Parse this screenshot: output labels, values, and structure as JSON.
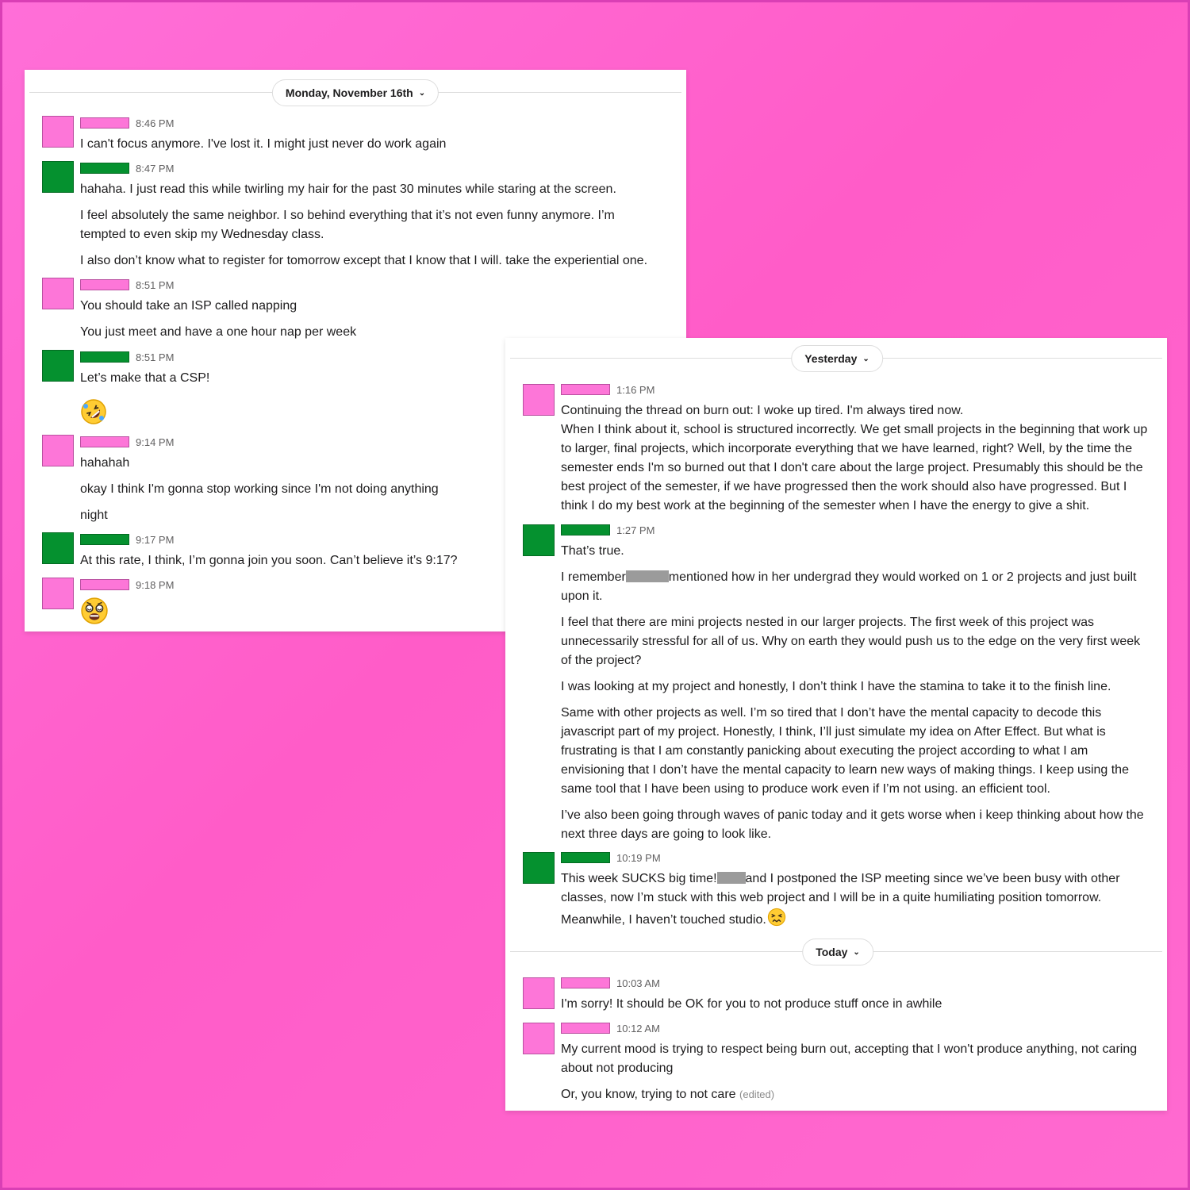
{
  "panel1": {
    "date_label": "Monday, November 16th",
    "messages": [
      {
        "time": "8:46 PM",
        "lines": [
          "I can't focus anymore. I've lost it. I might just never do work again"
        ]
      },
      {
        "time": "8:47 PM",
        "lines": [
          "hahaha. I just read this while twirling my hair for the past 30 minutes while staring at the screen.",
          "I feel absolutely the same neighbor. I so behind everything that it’s not even funny anymore. I’m tempted to even skip my Wednesday class.",
          "I also don’t know what to register for tomorrow except that I know that I will. take the experiential one."
        ]
      },
      {
        "time": "8:51 PM",
        "lines": [
          "You should take an ISP called napping",
          "You just meet and have a one hour nap per week"
        ]
      },
      {
        "time": "8:51 PM",
        "lines": [
          "Let’s make that a CSP!"
        ],
        "emoji": "rolling-on-floor-laughing-emoji"
      },
      {
        "time": "9:14 PM",
        "lines": [
          "hahahah",
          "okay I think I'm gonna stop working since I'm not doing anything",
          "night"
        ]
      },
      {
        "time": "9:17 PM",
        "lines": [
          "At this rate, I think, I’m gonna join you soon. Can’t believe it’s 9:17?"
        ]
      },
      {
        "time": "9:18 PM",
        "emoji": "dizzy-face-emoji"
      }
    ]
  },
  "panel2": {
    "date_label": "Yesterday",
    "today_label": "Today",
    "messages": [
      {
        "time": "1:16 PM",
        "lines": [
          "Continuing the thread on burn out: I woke up tired. I'm always tired now.",
          "When I think about it, school is structured incorrectly. We get small projects in the beginning that work up to larger, final projects, which incorporate everything that we have learned, right? Well, by the time the semester ends I'm so burned out that I don't care about the large project. Presumably this should be the best project of the semester, if we have progressed then the work should also have progressed. But I think I do my best work at the beginning of the semester when I have the energy to give a shit."
        ]
      },
      {
        "time": "1:27 PM",
        "lines": [
          "That’s true.",
          "I remember",
          "mentioned how in her undergrad they would worked on 1 or 2 projects and just built upon it.",
          "I feel that there are mini projects nested in our larger projects. The first week of this project was unnecessarily stressful for all of us. Why on earth they would push us to the edge on the very first week of the project?",
          "I was looking at my project and honestly, I don’t think I have the stamina to take it to the finish line.",
          "Same with other projects as well. I’m so tired that I don’t have the mental capacity to decode this javascript part of my project. Honestly, I think, I’ll just simulate my idea on After Effect. But what is frustrating is that I am constantly panicking about executing the project according to what I am envisioning that I don’t have the mental capacity to learn new ways of making things. I keep using the same tool that I have been using to produce work even if I’m not using. an efficient tool.",
          "I’ve also been going through waves of panic today and it gets worse when i keep thinking about how the next three days are going to look like."
        ]
      },
      {
        "time": "10:19 PM",
        "lines": [
          "This week SUCKS big time!",
          "and I postponed the ISP meeting since we’ve been busy with other classes, now I’m stuck with this web project and I will be in a quite humiliating position tomorrow. Meanwhile, I haven’t touched studio."
        ],
        "emoji": "confounded-face-emoji"
      },
      {
        "time": "10:03 AM",
        "lines": [
          "I'm sorry! It should be OK for you to not produce stuff once in awhile"
        ]
      },
      {
        "time": "10:12 AM",
        "lines": [
          "My current mood is trying to respect being burn out, accepting that I won't produce anything, not caring about not producing",
          "Or, you know, trying to not care"
        ],
        "edited": "(edited)"
      }
    ]
  },
  "colors": {
    "pink_user": "#fd76d8",
    "green_user": "#05912f",
    "background": "#ff66cc",
    "redaction": "#9b9b9b"
  }
}
